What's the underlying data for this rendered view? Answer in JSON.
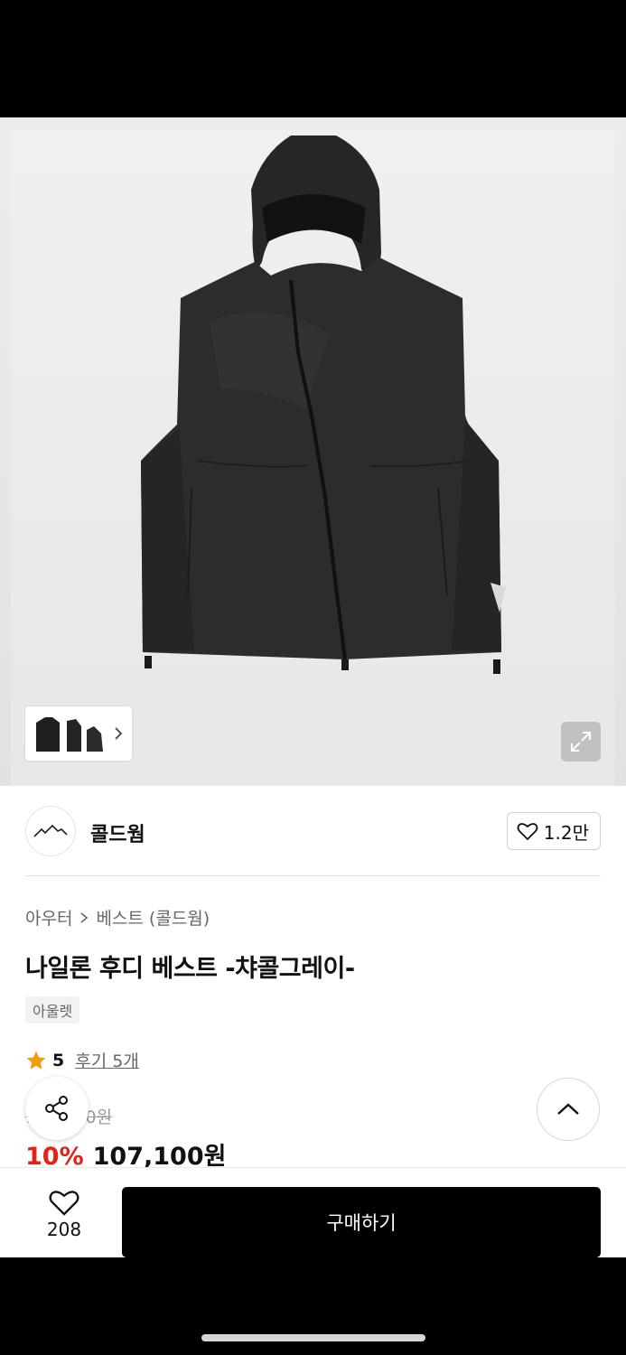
{
  "gallery": {
    "product_image_alt": "나일론 후디 베스트",
    "thumbnail_icon": "thumbnail-strip",
    "expand_icon": "expand-icon"
  },
  "brand": {
    "name": "콜드웜",
    "likes": "1.2만"
  },
  "product": {
    "breadcrumb": [
      "아우터",
      "베스트 (콜드웜)"
    ],
    "title": "나일론 후디 베스트 -챠콜그레이-",
    "tag": "아울렛",
    "rating": "5",
    "review_link": "후기 5개",
    "original_price": "119,000원",
    "discount": "10%",
    "price": "107,100원"
  },
  "bottom_bar": {
    "wish_count": "208",
    "buy_label": "구매하기"
  },
  "colors": {
    "discount": "#e2231a",
    "star": "#f39c12",
    "buy_button": "#000000"
  }
}
